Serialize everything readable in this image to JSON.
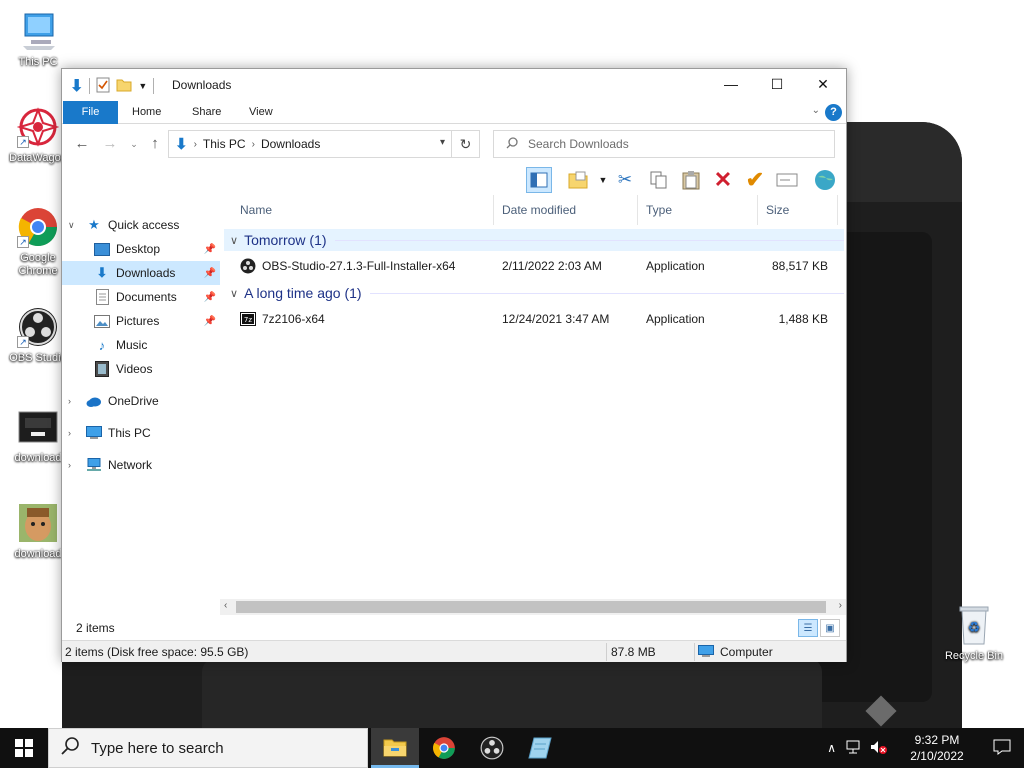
{
  "desktop": {
    "icons": [
      {
        "label": "This PC"
      },
      {
        "label": "DataWagon"
      },
      {
        "label": "Google Chrome"
      },
      {
        "label": "OBS Studio"
      },
      {
        "label": "download"
      },
      {
        "label": "download"
      },
      {
        "label": "Recycle Bin"
      }
    ]
  },
  "window": {
    "title": "Downloads",
    "controls": {
      "minimize": "—",
      "maximize": "☐",
      "close": "✕"
    },
    "ribbon_tabs": [
      "File",
      "Home",
      "Share",
      "View"
    ],
    "help": "?",
    "address": {
      "crumbs": [
        "This PC",
        "Downloads"
      ]
    },
    "search_placeholder": "Search Downloads",
    "nav": {
      "quick_access": "Quick access",
      "items": [
        "Desktop",
        "Downloads",
        "Documents",
        "Pictures",
        "Music",
        "Videos"
      ],
      "onedrive": "OneDrive",
      "this_pc": "This PC",
      "network": "Network"
    },
    "columns": [
      "Name",
      "Date modified",
      "Type",
      "Size"
    ],
    "groups": [
      {
        "label": "Tomorrow (1)",
        "files": [
          {
            "name": "OBS-Studio-27.1.3-Full-Installer-x64",
            "date": "2/11/2022 2:03 AM",
            "type": "Application",
            "size": "88,517 KB"
          }
        ]
      },
      {
        "label": "A long time ago (1)",
        "files": [
          {
            "name": "7z2106-x64",
            "date": "12/24/2021 3:47 AM",
            "type": "Application",
            "size": "1,488 KB"
          }
        ]
      }
    ],
    "item_count": "2 items",
    "status": {
      "left": "2 items (Disk free space: 95.5 GB)",
      "size": "87.8 MB",
      "location": "Computer"
    }
  },
  "taskbar": {
    "search_placeholder": "Type here to search",
    "time": "9:32 PM",
    "date": "2/10/2022"
  },
  "colors": {
    "accent": "#1979ca",
    "selection": "#cce8ff",
    "group_header": "#1e3287",
    "taskbar": "#101010"
  }
}
